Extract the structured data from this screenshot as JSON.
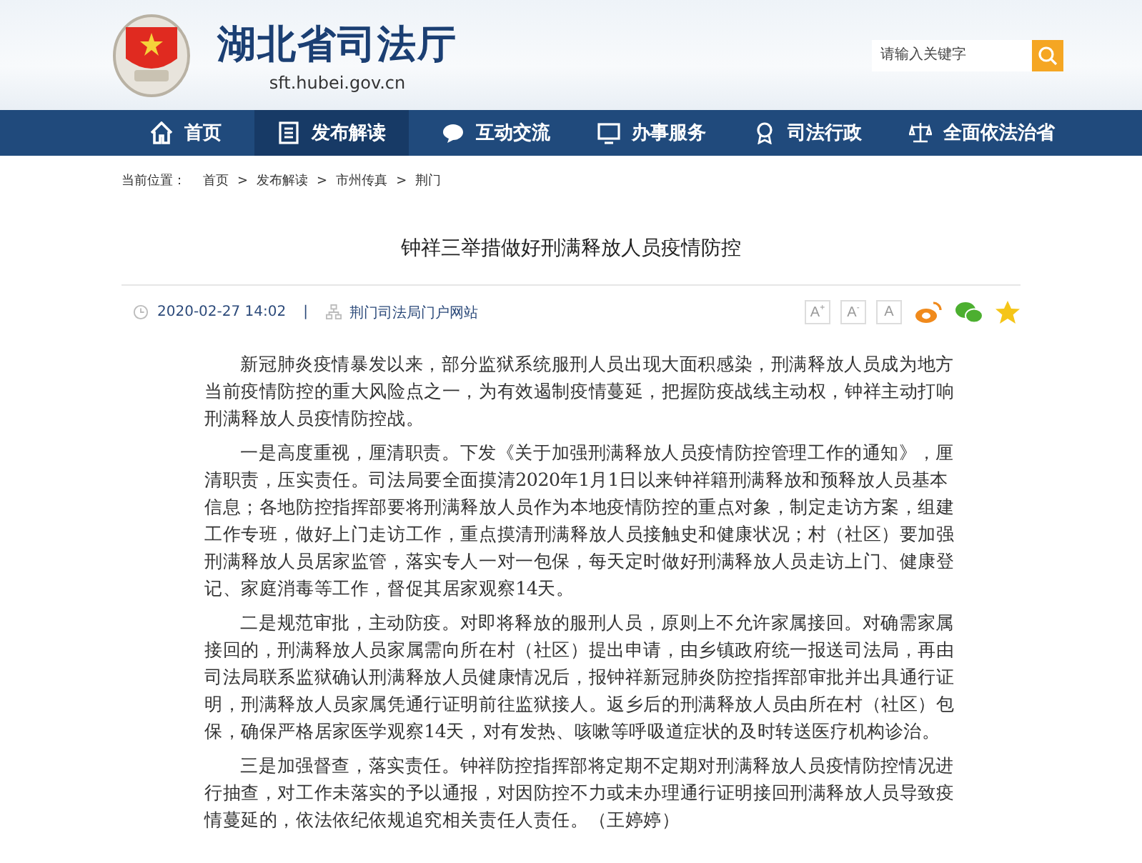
{
  "header": {
    "site_title": "湖北省司法厅",
    "site_url": "sft.hubei.gov.cn",
    "search": {
      "placeholder": "请输入关键字"
    }
  },
  "nav": [
    {
      "label": "首页",
      "selected": false
    },
    {
      "label": "发布解读",
      "selected": true
    },
    {
      "label": "互动交流",
      "selected": false
    },
    {
      "label": "办事服务",
      "selected": false
    },
    {
      "label": "司法行政",
      "selected": false
    },
    {
      "label": "全面依法治省",
      "selected": false
    }
  ],
  "breadcrumb": {
    "label": "当前位置：",
    "separator": ">",
    "items": [
      "首页",
      "发布解读",
      "市州传真",
      "荆门"
    ]
  },
  "article": {
    "title": "钟祥三举措做好刑满释放人员疫情防控",
    "date": "2020-02-27 14:02",
    "meta_separator": "|",
    "source": "荆门司法局门户网站",
    "font_buttons": [
      {
        "label": "A",
        "mark": "+"
      },
      {
        "label": "A",
        "mark": "-"
      },
      {
        "label": "A"
      }
    ],
    "paragraphs": [
      "新冠肺炎疫情暴发以来，部分监狱系统服刑人员出现大面积感染，刑满释放人员成为地方当前疫情防控的重大风险点之一，为有效遏制疫情蔓延，把握防疫战线主动权，钟祥主动打响刑满释放人员疫情防控战。",
      "一是高度重视，厘清职责。下发《关于加强刑满释放人员疫情防控管理工作的通知》，厘清职责，压实责任。司法局要全面摸清2020年1月1日以来钟祥籍刑满释放和预释放人员基本信息；各地防控指挥部要将刑满释放人员作为本地疫情防控的重点对象，制定走访方案，组建工作专班，做好上门走访工作，重点摸清刑满释放人员接触史和健康状况；村（社区）要加强刑满释放人员居家监管，落实专人一对一包保，每天定时做好刑满释放人员走访上门、健康登记、家庭消毒等工作，督促其居家观察14天。",
      "二是规范审批，主动防疫。对即将释放的服刑人员，原则上不允许家属接回。对确需家属接回的，刑满释放人员家属需向所在村（社区）提出申请，由乡镇政府统一报送司法局，再由司法局联系监狱确认刑满释放人员健康情况后，报钟祥新冠肺炎防控指挥部审批并出具通行证明，刑满释放人员家属凭通行证明前往监狱接人。返乡后的刑满释放人员由所在村（社区）包保，确保严格居家医学观察14天，对有发热、咳嗽等呼吸道症状的及时转送医疗机构诊治。",
      "三是加强督查，落实责任。钟祥防控指挥部将定期不定期对刑满释放人员疫情防控情况进行抽查，对工作未落实的予以通报，对因防控不力或未办理通行证明接回刑满释放人员导致疫情蔓延的，依法依纪依规追究相关责任人责任。（王婷婷）"
    ]
  }
}
